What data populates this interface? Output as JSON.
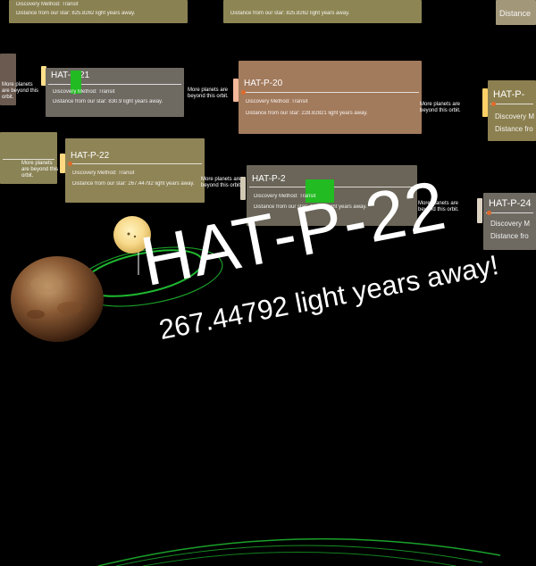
{
  "scene": {
    "planet_name": "HAT-P-22",
    "distance_text": "267.44792 light years away!"
  },
  "cards": [
    {
      "title": "HAT-P-20",
      "line1": "Discovery Method: Transit",
      "line2": "Distance from our star: 228.82821 light years away.",
      "more": "More planets are beyond this orbit."
    },
    {
      "title": "HAT-P-2",
      "line1": "Discovery Method: Transit",
      "line2": "Distance from our star: 419.91 light years away.",
      "more": "More planets are beyond this orbit."
    },
    {
      "title": "HAT-P-22",
      "line1": "Discovery Method: Transit",
      "line2": "Distance from our star: 267.44792 light years away.",
      "more": "More planets are beyond this orbit."
    },
    {
      "title": "HAT-P-21",
      "line1": "Discovery Method: Transit",
      "line2": "Distance from our star: 830.9 light years away.",
      "more": "More planets are beyond this orbit."
    },
    {
      "title": "HAT-P-",
      "line1": "Discovery M",
      "line2": "Distance fro"
    },
    {
      "title": "HAT-P-24",
      "line1": "Discovery M",
      "line2": "Distance fro"
    },
    {
      "title": "",
      "line1": "Discovery Method: Transit",
      "line2": "Distance from our star: 825.8262 light years away."
    },
    {
      "title": "",
      "line1": "",
      "line2": "Distance"
    }
  ],
  "colors": {
    "background": "#000000",
    "orbit": "#22cc33",
    "highlight": "#22bb22",
    "card_brown": "#a07a5a",
    "card_grey": "#6e6a60",
    "card_olive": "#8d8350"
  },
  "icons": {
    "star": "star-sphere",
    "planet": "rocky-planet"
  }
}
